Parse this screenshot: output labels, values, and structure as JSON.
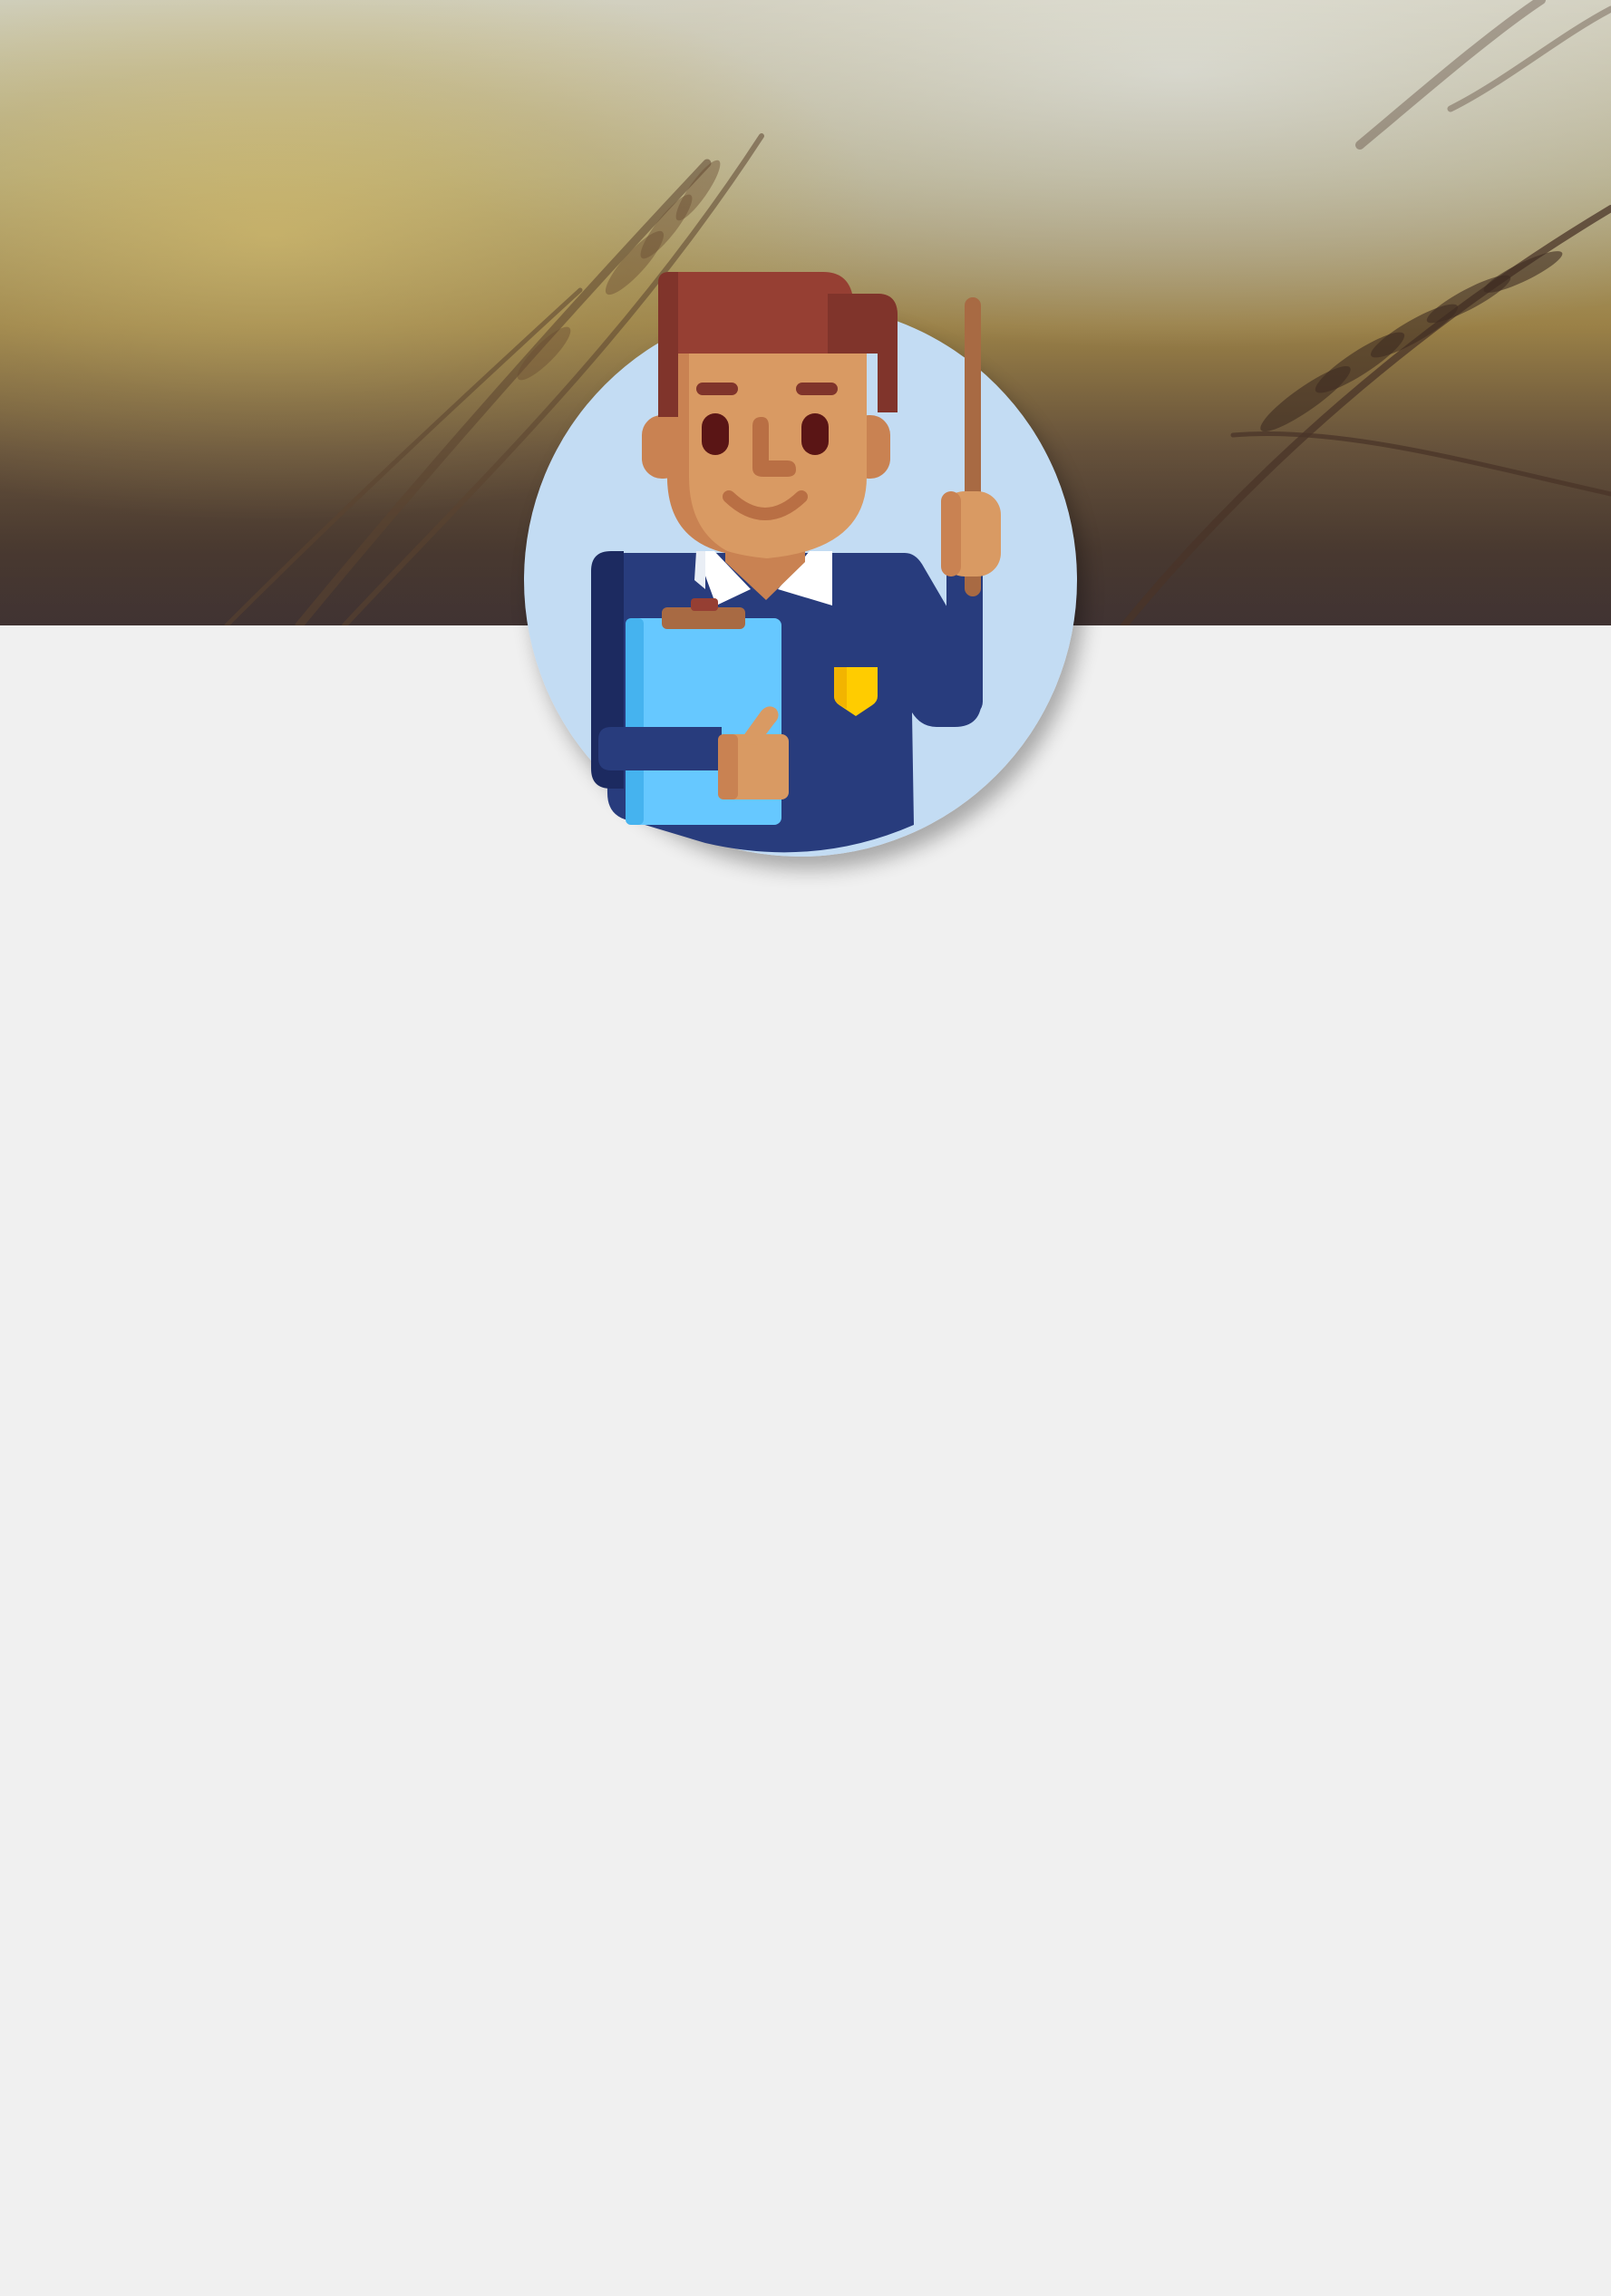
{
  "page": {
    "background_color": "#f0f0f0"
  },
  "cover": {
    "image_name": "wheat-field-sunset-image",
    "colors": [
      "#cfcfbf",
      "#c7c08e",
      "#b89a52",
      "#574535"
    ]
  },
  "profile": {
    "avatar_name": "teacher-avatar",
    "circle_color": "#c3dcf3",
    "palette": {
      "hair": "#963f33",
      "skin": "#d99a63",
      "shirt": "#283c7d",
      "clipboard": "#66c8ff",
      "pointer": "#a86a43",
      "badge": "#ffcc00"
    }
  }
}
